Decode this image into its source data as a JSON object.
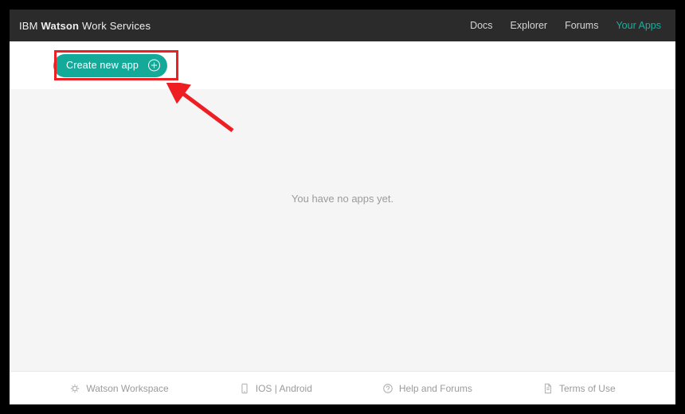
{
  "header": {
    "brand_prefix": "IBM",
    "brand_bold": "Watson",
    "brand_suffix": " Work Services",
    "nav": {
      "docs": "Docs",
      "explorer": "Explorer",
      "forums": "Forums",
      "your_apps": "Your Apps"
    }
  },
  "toolbar": {
    "create_label": "Create new app"
  },
  "main": {
    "empty_message": "You have no apps yet."
  },
  "footer": {
    "watson_workspace": "Watson Workspace",
    "ios_android": "IOS | Android",
    "help_forums": "Help and Forums",
    "terms": "Terms of Use"
  },
  "annotation": {
    "arrow_color": "#ee1f23",
    "highlight_color": "#ee1f23"
  }
}
